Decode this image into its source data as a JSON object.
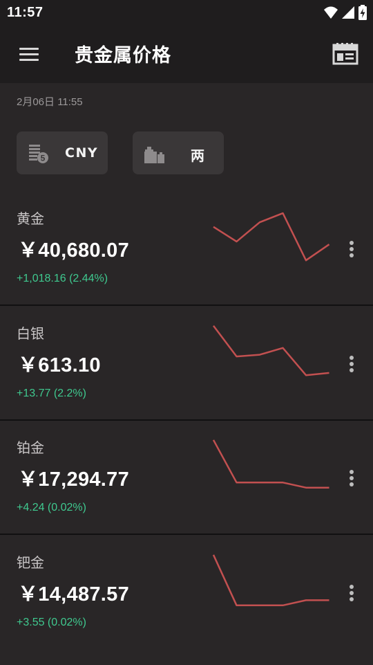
{
  "status_bar": {
    "time": "11:57",
    "icons": [
      "wifi-icon",
      "cell-signal-icon",
      "battery-charging-icon"
    ]
  },
  "app_bar": {
    "title": "贵金属价格",
    "menu_icon": "hamburger-menu-icon",
    "action_icon": "calendar-icon"
  },
  "update_time": "2月06日 11:55",
  "selectors": {
    "currency": {
      "label": "CNY",
      "icon": "currency-coins-icon"
    },
    "unit": {
      "label": "两",
      "icon": "weight-scale-icon"
    }
  },
  "colors": {
    "background": "#292627",
    "bar": "#1f1d1e",
    "chip": "#3a3738",
    "change_positive": "#3fc98f",
    "sparkline": "#c25050"
  },
  "metals": [
    {
      "name": "黄金",
      "price": "￥40,680.07",
      "change": "+1,018.16 (2.44%)",
      "trend": [
        0.71,
        0.45,
        0.79,
        0.95,
        0.12,
        0.4
      ]
    },
    {
      "name": "白银",
      "price": "￥613.10",
      "change": "+13.77 (2.2%)",
      "trend": [
        0.99,
        0.45,
        0.48,
        0.6,
        0.12,
        0.16
      ]
    },
    {
      "name": "铂金",
      "price": "￥17,294.77",
      "change": "+4.24 (0.02%)",
      "trend": [
        0.99,
        0.24,
        0.24,
        0.24,
        0.15,
        0.15
      ]
    },
    {
      "name": "钯金",
      "price": "￥14,487.57",
      "change": "+3.55 (0.02%)",
      "trend": [
        0.99,
        0.1,
        0.1,
        0.1,
        0.19,
        0.19
      ]
    }
  ]
}
